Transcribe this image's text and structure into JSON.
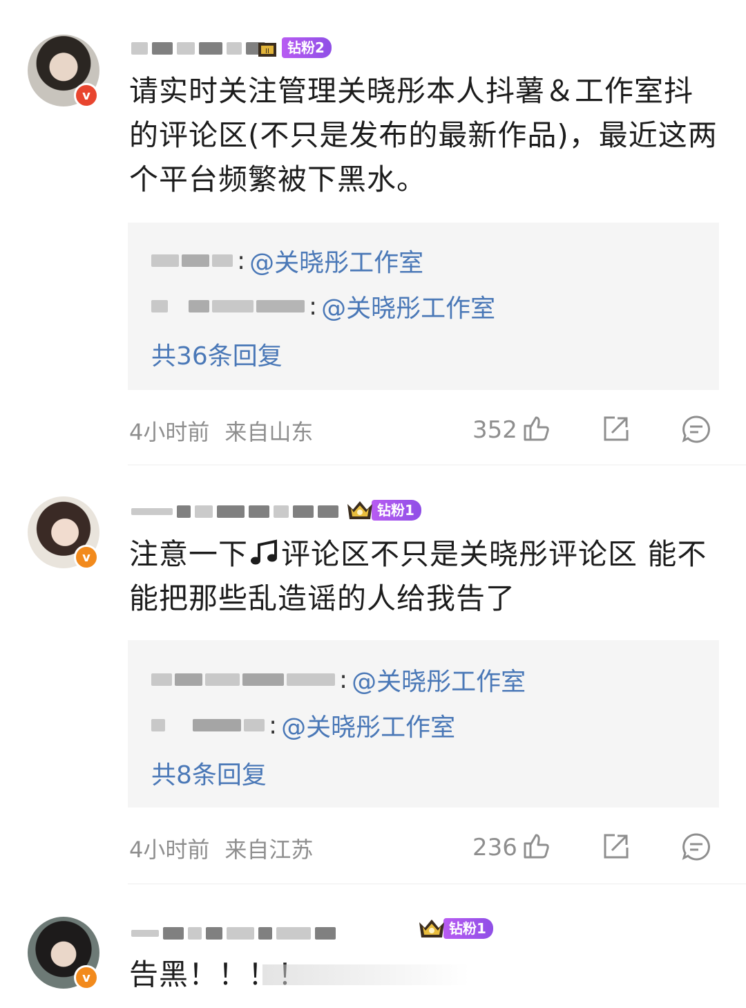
{
  "comments": [
    {
      "fan_badge": "钻粉2",
      "text": "请实时关注管理关晓彤本人抖薯＆工作室抖的评论区(不只是发布的最新作品)，最近这两个平台频繁被下黑水。",
      "replies": [
        {
          "mention": "@关晓彤工作室"
        },
        {
          "mention": "@关晓彤工作室"
        }
      ],
      "reply_count": "共36条回复",
      "time": "4小时前",
      "location": "来自山东",
      "likes": "352"
    },
    {
      "fan_badge": "钻粉1",
      "text_before": "注意一下",
      "text_after": "评论区不只是关晓彤评论区 能不能把那些乱造谣的人给我告了",
      "replies": [
        {
          "mention": "@关晓彤工作室"
        },
        {
          "mention": "@关晓彤工作室"
        }
      ],
      "reply_count": "共8条回复",
      "time": "4小时前",
      "location": "来自江苏",
      "likes": "236"
    },
    {
      "fan_badge": "钻粉1",
      "text": "告黑！！！！"
    }
  ],
  "icons": [
    "thumbs-up-icon",
    "share-icon",
    "comment-icon",
    "verified-v-icon",
    "crown-icon",
    "music-note-icon"
  ],
  "colors": {
    "mention": "#4a78b7",
    "badge_purple": "#9b55ee",
    "verified_orange": "#f28a1c",
    "verified_red": "#e8452f"
  }
}
